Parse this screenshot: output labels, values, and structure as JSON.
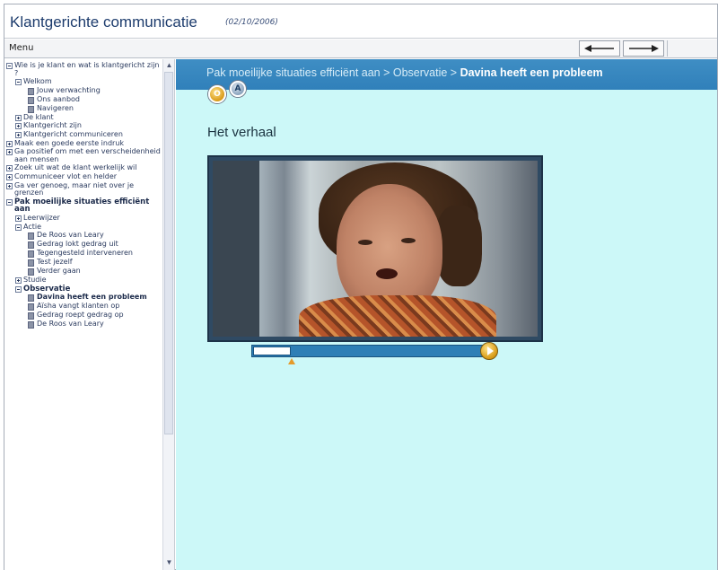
{
  "app": {
    "title": "Klantgerichte communicatie",
    "date": "(02/10/2006)"
  },
  "menubar": {
    "menu_label": "Menu",
    "back_icon": "arrow-left-icon",
    "forward_icon": "arrow-right-icon"
  },
  "sidebar": {
    "tree": [
      {
        "label": "Wie is je klant en wat is klantgericht zijn ?",
        "level": 1,
        "toggle": "minus"
      },
      {
        "label": "Welkom",
        "level": 2,
        "toggle": "minus"
      },
      {
        "label": "Jouw verwachting",
        "level": 3,
        "toggle": "page"
      },
      {
        "label": "Ons aanbod",
        "level": 3,
        "toggle": "page"
      },
      {
        "label": "Navigeren",
        "level": 3,
        "toggle": "page"
      },
      {
        "label": "De klant",
        "level": 2,
        "toggle": "plus"
      },
      {
        "label": "Klantgericht zijn",
        "level": 2,
        "toggle": "plus"
      },
      {
        "label": "Klantgericht communiceren",
        "level": 2,
        "toggle": "plus"
      },
      {
        "label": "Maak een goede eerste indruk",
        "level": 1,
        "toggle": "plus"
      },
      {
        "label": "Ga positief om met een verscheidenheid aan mensen",
        "level": 1,
        "toggle": "plus"
      },
      {
        "label": "Zoek uit wat de klant werkelijk wil",
        "level": 1,
        "toggle": "plus"
      },
      {
        "label": "Communiceer vlot en helder",
        "level": 1,
        "toggle": "plus"
      },
      {
        "label": "Ga ver genoeg, maar niet over je grenzen",
        "level": 1,
        "toggle": "plus"
      },
      {
        "label": "Pak moeilijke situaties efficiënt aan",
        "level": 1,
        "toggle": "minus",
        "bold": true
      },
      {
        "label": "Leerwijzer",
        "level": 2,
        "toggle": "plus"
      },
      {
        "label": "Actie",
        "level": 2,
        "toggle": "minus"
      },
      {
        "label": "De Roos van Leary",
        "level": 3,
        "toggle": "page"
      },
      {
        "label": "Gedrag lokt gedrag uit",
        "level": 3,
        "toggle": "page"
      },
      {
        "label": "Tegengesteld interveneren",
        "level": 3,
        "toggle": "page"
      },
      {
        "label": "Test jezelf",
        "level": 3,
        "toggle": "page"
      },
      {
        "label": "Verder gaan",
        "level": 3,
        "toggle": "page"
      },
      {
        "label": "Studie",
        "level": 2,
        "toggle": "plus"
      },
      {
        "label": "Observatie",
        "level": 2,
        "toggle": "minus",
        "bold": true
      },
      {
        "label": "Davina heeft een probleem",
        "level": 3,
        "toggle": "page",
        "selected": true
      },
      {
        "label": "Aïsha vangt klanten op",
        "level": 3,
        "toggle": "page"
      },
      {
        "label": "Gedrag roept gedrag op",
        "level": 3,
        "toggle": "page"
      },
      {
        "label": "De Roos van Leary",
        "level": 3,
        "toggle": "page"
      }
    ],
    "scroll_up_icon": "chevron-up-icon",
    "scroll_down_icon": "chevron-down-icon"
  },
  "breadcrumb": {
    "parts": "Pak moeilijke situaties efficiënt aan > Observatie > ",
    "current": "Davina heeft een probleem"
  },
  "tabs": {
    "observatie_icon": "observation-icon",
    "actie_icon": "action-icon"
  },
  "main": {
    "section_title": "Het verhaal",
    "video_icon": "video-frame",
    "play_icon": "play-icon",
    "progress": 0.16
  },
  "colors": {
    "crumb_bar": "#3080ba",
    "content_bg": "#ccf8f8",
    "title_text": "#1d3c6d",
    "accent_gold": "#d69914"
  }
}
